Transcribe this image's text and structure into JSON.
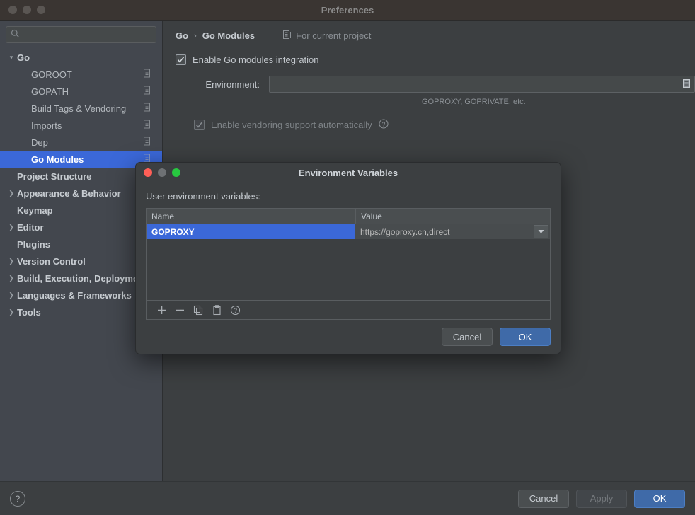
{
  "window": {
    "title": "Preferences",
    "traffic_lights": [
      "close-inactive",
      "minimize-inactive",
      "zoom-inactive"
    ]
  },
  "search": {
    "value": "",
    "placeholder": "",
    "icon": "search-icon"
  },
  "sidebar": {
    "items": [
      {
        "label": "Go",
        "level": "group",
        "arrow": "⌄",
        "expanded": true,
        "selected": false,
        "icon": null
      },
      {
        "label": "GOROOT",
        "level": "child",
        "arrow": "",
        "expanded": false,
        "selected": false,
        "icon": "project-scope-icon"
      },
      {
        "label": "GOPATH",
        "level": "child",
        "arrow": "",
        "expanded": false,
        "selected": false,
        "icon": "project-scope-icon"
      },
      {
        "label": "Build Tags & Vendoring",
        "level": "child",
        "arrow": "",
        "expanded": false,
        "selected": false,
        "icon": "project-scope-icon"
      },
      {
        "label": "Imports",
        "level": "child",
        "arrow": "",
        "expanded": false,
        "selected": false,
        "icon": "project-scope-icon"
      },
      {
        "label": "Dep",
        "level": "child",
        "arrow": "",
        "expanded": false,
        "selected": false,
        "icon": "project-scope-icon"
      },
      {
        "label": "Go Modules",
        "level": "child",
        "arrow": "",
        "expanded": false,
        "selected": true,
        "icon": "project-scope-icon"
      },
      {
        "label": "Project Structure",
        "level": "group-noarrow",
        "arrow": "",
        "expanded": false,
        "selected": false,
        "icon": null
      },
      {
        "label": "Appearance & Behavior",
        "level": "group",
        "arrow": "›",
        "expanded": false,
        "selected": false,
        "icon": null
      },
      {
        "label": "Keymap",
        "level": "group-noarrow",
        "arrow": "",
        "expanded": false,
        "selected": false,
        "icon": null
      },
      {
        "label": "Editor",
        "level": "group",
        "arrow": "›",
        "expanded": false,
        "selected": false,
        "icon": null
      },
      {
        "label": "Plugins",
        "level": "group-noarrow",
        "arrow": "",
        "expanded": false,
        "selected": false,
        "icon": null
      },
      {
        "label": "Version Control",
        "level": "group",
        "arrow": "›",
        "expanded": false,
        "selected": false,
        "icon": null
      },
      {
        "label": "Build, Execution, Deployment",
        "level": "group",
        "arrow": "›",
        "expanded": false,
        "selected": false,
        "icon": null
      },
      {
        "label": "Languages & Frameworks",
        "level": "group",
        "arrow": "›",
        "expanded": false,
        "selected": false,
        "icon": null
      },
      {
        "label": "Tools",
        "level": "group",
        "arrow": "›",
        "expanded": false,
        "selected": false,
        "icon": null
      }
    ]
  },
  "main": {
    "breadcrumb": {
      "parent": "Go",
      "separator": "›",
      "current": "Go Modules"
    },
    "scope": {
      "label": "For current project",
      "icon": "project-scope-icon"
    },
    "enable_modules": {
      "label": "Enable Go modules integration",
      "checked": true,
      "enabled": true
    },
    "environment": {
      "label": "Environment:",
      "value": "",
      "placeholder": "",
      "browse_icon": "list-editor-icon"
    },
    "environment_hint": "GOPROXY, GOPRIVATE, etc.",
    "vendoring": {
      "label": "Enable vendoring support automatically",
      "checked": true,
      "enabled": false,
      "help_icon": "help-circle-icon"
    }
  },
  "footer": {
    "help": {
      "icon": "help-circle-icon",
      "label": "?"
    },
    "cancel": "Cancel",
    "apply": "Apply",
    "apply_enabled": false,
    "ok": "OK"
  },
  "dialog": {
    "title": "Environment Variables",
    "traffic_lights": [
      "close",
      "minimize",
      "zoom"
    ],
    "caption": "User environment variables:",
    "table": {
      "columns": [
        "Name",
        "Value"
      ],
      "rows": [
        {
          "name": "GOPROXY",
          "value": "https://goproxy.cn,direct",
          "selected": true,
          "has_dropdown": true
        }
      ]
    },
    "toolbar": [
      {
        "name": "add-button",
        "icon": "plus-icon",
        "glyph": "+"
      },
      {
        "name": "remove-button",
        "icon": "minus-icon",
        "glyph": "−"
      },
      {
        "name": "copy-button",
        "icon": "copy-icon",
        "glyph": ""
      },
      {
        "name": "paste-button",
        "icon": "paste-icon",
        "glyph": ""
      },
      {
        "name": "help-button",
        "icon": "help-circle-icon",
        "glyph": "?"
      }
    ],
    "cancel": "Cancel",
    "ok": "OK"
  },
  "colors": {
    "accent_selection": "#3b68d8",
    "primary_button": "#3f6aa8",
    "panel_bg": "#3c3f41",
    "sidebar_bg": "#43474e",
    "titlebar_bg": "#3a3532",
    "light_red": "#ff5f57",
    "light_gray": "#6e7174",
    "light_green": "#28c840"
  }
}
